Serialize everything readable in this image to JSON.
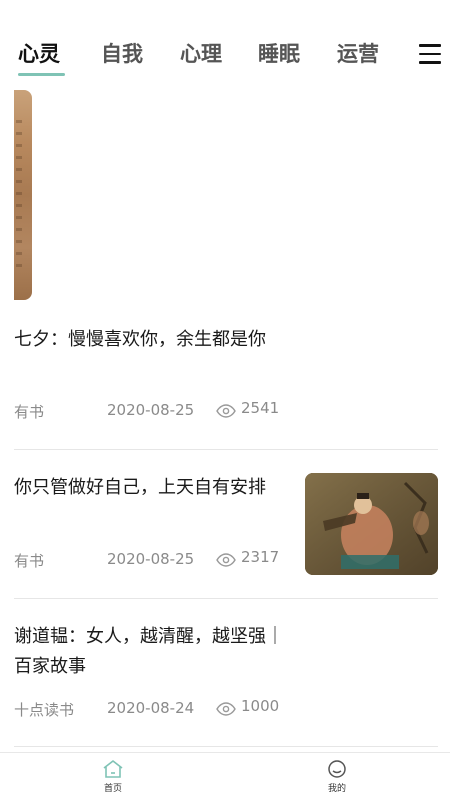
{
  "tabs": [
    {
      "label": "心灵",
      "active": true
    },
    {
      "label": "自我"
    },
    {
      "label": "心理"
    },
    {
      "label": "睡眠"
    },
    {
      "label": "运营"
    }
  ],
  "menu_icon": "hamburger-menu-icon",
  "articles": [
    {
      "title": "七夕：慢慢喜欢你，余生都是你",
      "source": "有书",
      "date": "2020-08-25",
      "views": "2541"
    },
    {
      "title": "你只管做好自己，上天自有安排",
      "source": "有书",
      "date": "2020-08-25",
      "views": "2317"
    },
    {
      "title": "谢道韫：女人，越清醒，越坚强｜百家故事",
      "source": "十点读书",
      "date": "2020-08-24",
      "views": "1000"
    }
  ],
  "bottom_nav": [
    {
      "label": "首页",
      "icon": "home-icon",
      "active_color": "#7fc3b5"
    },
    {
      "label": "我的",
      "icon": "profile-icon"
    }
  ],
  "colors": {
    "accent": "#7fc3b5",
    "meta_text": "#8a8a8a"
  }
}
